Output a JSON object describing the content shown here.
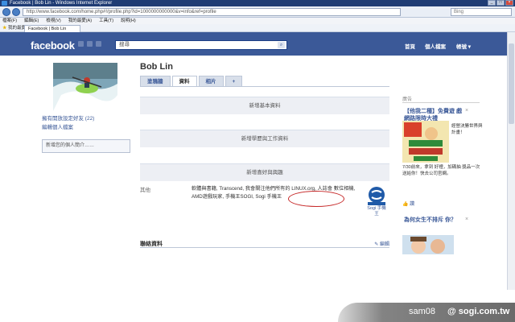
{
  "browser": {
    "window_title": "Facebook | Bob Lin - Windows Internet Explorer",
    "url": "http://www.facebook.com/home.php#!/profile.php?id=1000000000000&v=info&ref=profile",
    "search_placeholder": "Bing",
    "menu": [
      "檔案(F)",
      "編輯(E)",
      "檢視(V)",
      "我的最愛(A)",
      "工具(T)",
      "說明(H)"
    ],
    "favorites_label": "我的最愛",
    "tab_title": "Facebook | Bob Lin"
  },
  "fb": {
    "logo": "facebook",
    "search_value": "搜尋",
    "nav": {
      "home": "首頁",
      "profile": "個人檔案",
      "account": "帳號 ▾"
    }
  },
  "profile": {
    "name": "Bob Lin",
    "tabs": [
      "塗鴉牆",
      "資料",
      "相片",
      "+"
    ],
    "left_links": [
      "擁有開放設定好友 (22)",
      "編輯個人檔案"
    ],
    "left_box": "新增您的個人簡介……",
    "sections": [
      "新增基本資料",
      "新增學歷與工作資料",
      "新增喜好與興趣"
    ],
    "other_label": "其他",
    "other_text": "軟體與書籍, Transcend, 我會關注他們所有的 LINUX.org, 人誌會 數位相機, AMD遊戲玩家, 手機王SOGI, Sogi 手機王",
    "sogi_caption": "Sogi 手機 王",
    "contact_label": "聯絡資料",
    "edit_label": "✎ 編輯"
  },
  "ads": {
    "header": "廣告",
    "ad1_title": "【他我二種】免費遊 戲網路限時大禮",
    "ad1_text": "經營決勝世界與計畫！",
    "ad1_body": "7/30前來，拿到 好禮，加碼抽 獎品一次送給你！快去公司官網。",
    "ad1_like": "👍 讚",
    "ad2_title": "為何女生不排斥 你？"
  },
  "watermark": {
    "user": "sam08",
    "site": "@ sogi.com.tw"
  },
  "colors": {
    "fb_blue": "#3b5998",
    "annotation_red": "#c62828"
  }
}
